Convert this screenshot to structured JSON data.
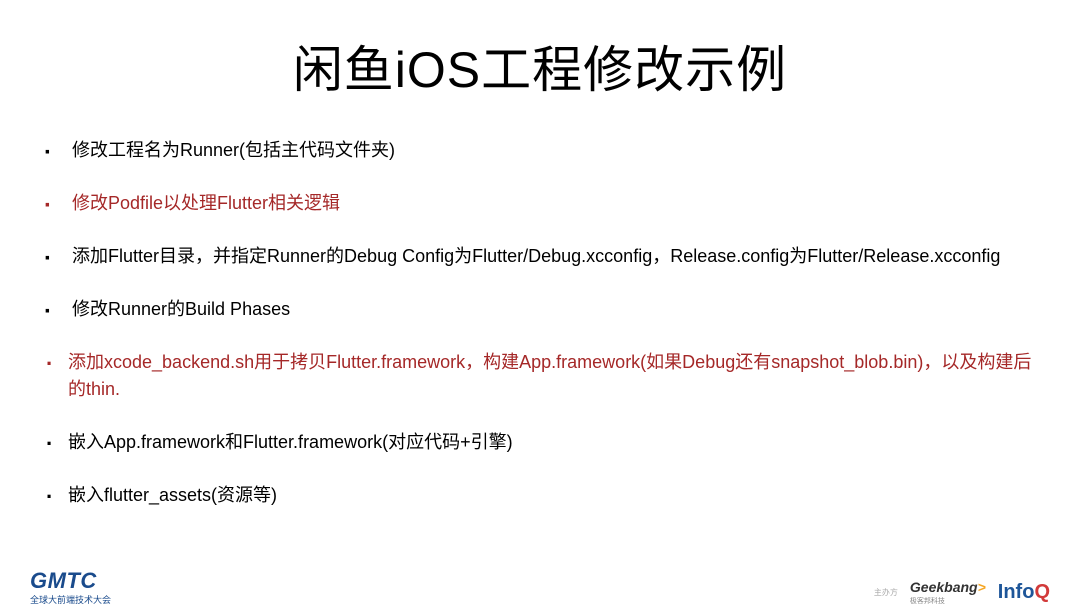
{
  "slide": {
    "title": "闲鱼iOS工程修改示例",
    "bullets": {
      "b1": "修改工程名为Runner(包括主代码文件夹)",
      "b2": "修改Podfile以处理Flutter相关逻辑",
      "b3": "添加Flutter目录，并指定Runner的Debug Config为Flutter/Debug.xcconfig，Release.config为Flutter/Release.xcconfig",
      "b4": "修改Runner的Build Phases",
      "sub": {
        "s1": "添加xcode_backend.sh用于拷贝Flutter.framework，构建App.framework(如果Debug还有snapshot_blob.bin)，以及构建后的thin.",
        "s2": "嵌入App.framework和Flutter.framework(对应代码+引擎)",
        "s3": "嵌入flutter_assets(资源等)"
      }
    }
  },
  "footer": {
    "gmtc": "GMTC",
    "gmtc_sub": "全球大前端技术大会",
    "sponsor_label": "主办方",
    "geekbang": "Geekbang",
    "geekbang_arrow": ">",
    "geekbang_sub": "极客邦科技",
    "infoq_pre": "Info",
    "infoq_q": "Q"
  }
}
